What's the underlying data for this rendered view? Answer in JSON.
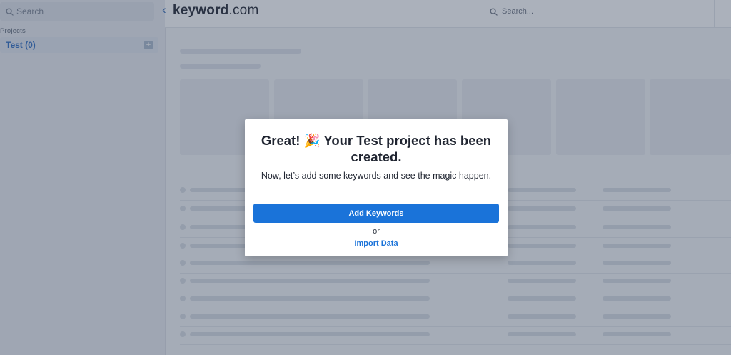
{
  "sidebar": {
    "search_placeholder": "Search",
    "projects_heading": "Projects",
    "projects": [
      {
        "label": "Test (0)",
        "add_icon": "plus-icon"
      }
    ]
  },
  "topbar": {
    "back_icon": "chevron-left-icon",
    "brand_name": "keyword",
    "brand_domain": ".com",
    "search_placeholder": "Search..."
  },
  "modal": {
    "title": "Great! 🎉 Your Test project has been created.",
    "subtitle": "Now, let’s add some keywords and see the magic happen.",
    "primary_button": "Add Keywords",
    "or_text": "or",
    "secondary_link": "Import Data"
  },
  "colors": {
    "accent": "#1a73d9",
    "overlay": "rgba(55,68,92,0.42)",
    "sidebar_bg": "#ebedf1"
  }
}
